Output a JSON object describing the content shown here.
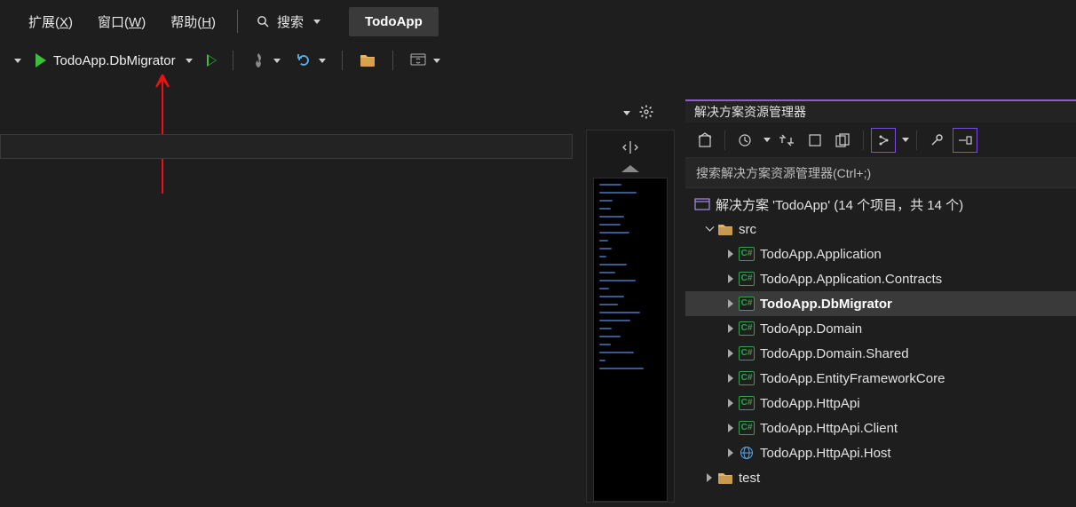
{
  "menu": {
    "extensions": "扩展(X)",
    "window": "窗口(W)",
    "help": "帮助(H)",
    "search_label": "搜索"
  },
  "title_chip": "TodoApp",
  "toolbar": {
    "startup_project": "TodoApp.DbMigrator"
  },
  "solution_explorer": {
    "title": "解决方案资源管理器",
    "search_placeholder": "搜索解决方案资源管理器(Ctrl+;)",
    "root": "解决方案 'TodoApp' (14 个项目，共 14 个)",
    "folders": {
      "src": "src",
      "test": "test"
    },
    "projects": [
      "TodoApp.Application",
      "TodoApp.Application.Contracts",
      "TodoApp.DbMigrator",
      "TodoApp.Domain",
      "TodoApp.Domain.Shared",
      "TodoApp.EntityFrameworkCore",
      "TodoApp.HttpApi",
      "TodoApp.HttpApi.Client",
      "TodoApp.HttpApi.Host"
    ],
    "selected_project_index": 2,
    "host_project_index": 8
  }
}
